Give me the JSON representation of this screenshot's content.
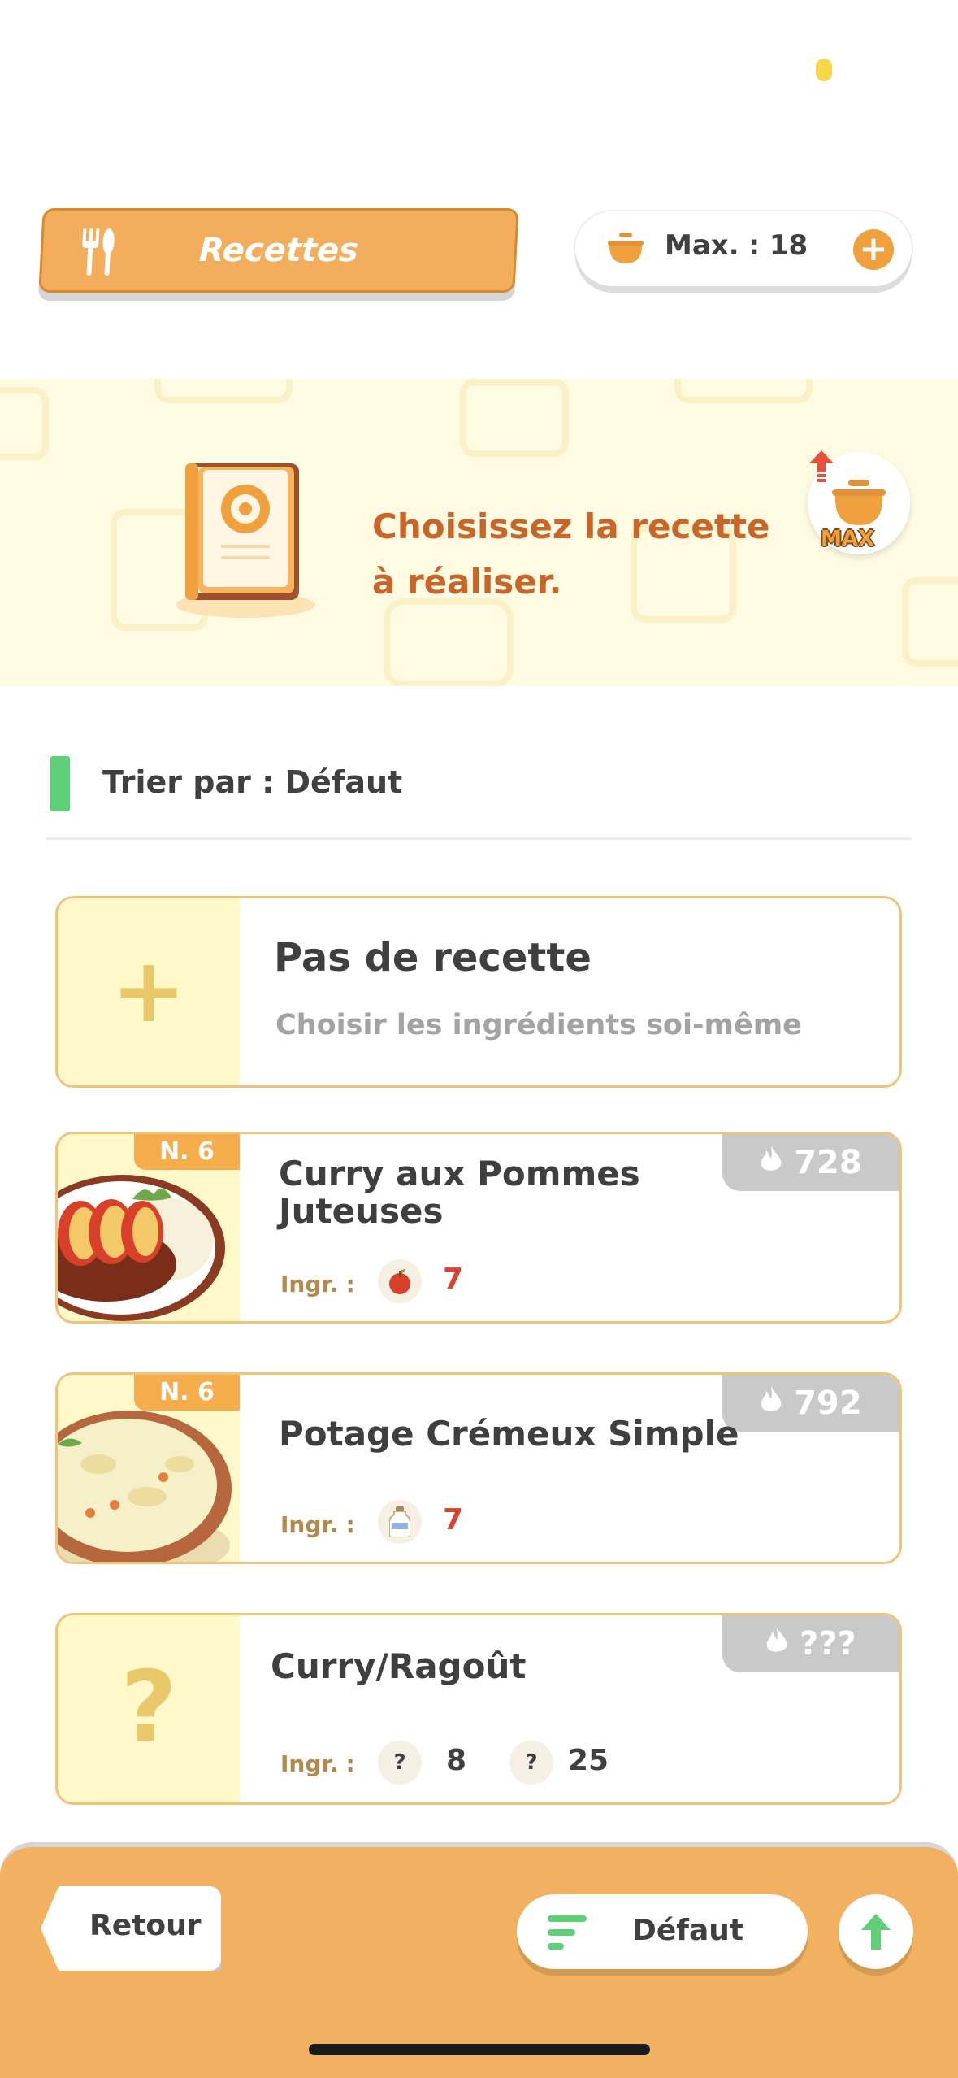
{
  "header": {
    "recipes_label": "Recettes",
    "max_label": "Max. : 18",
    "plus_symbol": "+"
  },
  "banner": {
    "message_line1": "Choisissez la recette",
    "message_line2": "à réaliser.",
    "max_badge": "MAX"
  },
  "sort": {
    "label": "Trier par : Défaut"
  },
  "cards": [
    {
      "title": "Pas de recette",
      "subtitle": "Choisir les ingrédients soi-même",
      "thumb_symbol": "+"
    },
    {
      "badge": "N. 6",
      "title_line1": "Curry aux Pommes",
      "title_line2": "Juteuses",
      "energy": "728",
      "ingr_label": "Ingr. :",
      "ingredient_icon": "apple-icon",
      "qty": "7"
    },
    {
      "badge": "N. 6",
      "title": "Potage Crémeux Simple",
      "energy": "792",
      "ingr_label": "Ingr. :",
      "ingredient_icon": "milk-bottle-icon",
      "qty": "7"
    },
    {
      "title": "Curry/Ragoût",
      "energy": "???",
      "thumb_symbol": "?",
      "ingr_label": "Ingr. :",
      "ingredients": [
        {
          "icon": "?",
          "qty": "8"
        },
        {
          "icon": "?",
          "qty": "25"
        }
      ]
    }
  ],
  "bottom": {
    "back_label": "Retour",
    "sort_label": "Défaut"
  },
  "colors": {
    "accent_orange": "#f2ae5c",
    "card_border": "#efc37a",
    "sort_green": "#5fcf78",
    "banner_text": "#c8662a",
    "qty_red": "#d9432f"
  }
}
